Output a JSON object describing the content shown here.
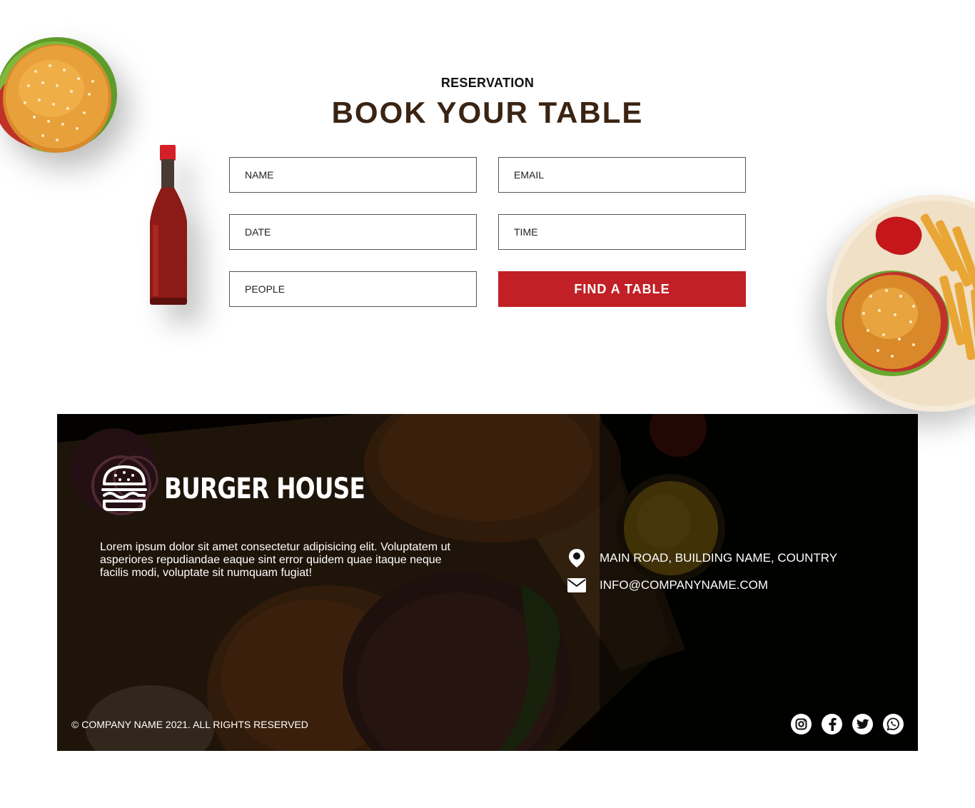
{
  "reservation": {
    "eyebrow": "RESERVATION",
    "title": "BOOK YOUR TABLE",
    "fields": {
      "name_placeholder": "NAME",
      "email_placeholder": "EMAIL",
      "date_placeholder": "DATE",
      "time_placeholder": "TIME",
      "people_placeholder": "PEOPLE"
    },
    "submit_label": "FIND A TABLE"
  },
  "footer": {
    "brand": "BURGER HOUSE",
    "about": "Lorem ipsum dolor sit amet consectetur adipisicing elit. Voluptatem ut asperiores repudiandae eaque sint error quidem quae itaque neque facilis modi, voluptate sit numquam fugiat!",
    "address": "MAIN ROAD, BUILDING NAME, COUNTRY",
    "email": "INFO@COMPANYNAME.COM",
    "copyright": "© COMPANY NAME 2021. ALL RIGHTS RESERVED",
    "socials": [
      "instagram-icon",
      "facebook-icon",
      "twitter-icon",
      "whatsapp-icon"
    ]
  },
  "colors": {
    "accent": "#c12126",
    "title": "#3b2413",
    "footer_bg": "#050302"
  }
}
